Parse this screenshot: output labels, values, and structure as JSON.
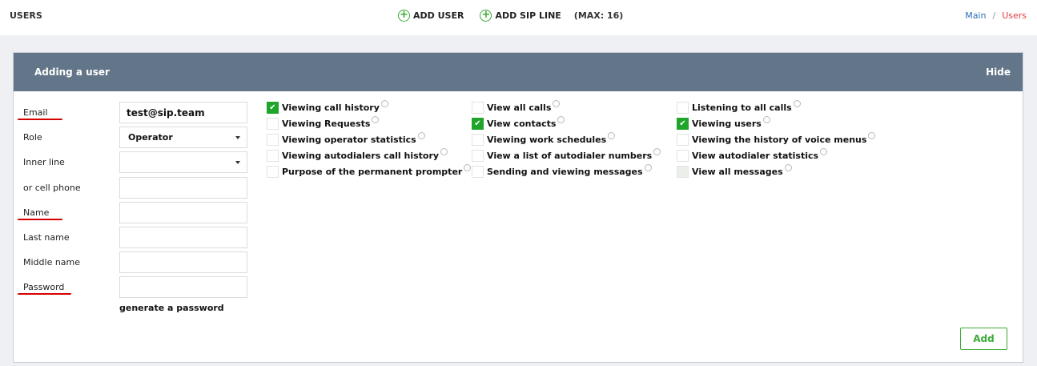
{
  "header": {
    "title": "USERS",
    "add_user": "ADD USER",
    "add_sip_line": "ADD SIP LINE",
    "max": "(MAX: 16)"
  },
  "breadcrumb": {
    "main": "Main",
    "sep": "/",
    "current": "Users"
  },
  "panel": {
    "title": "Adding a user",
    "hide": "Hide"
  },
  "form": {
    "email_label": "Email",
    "email_value": "test@sip.team",
    "role_label": "Role",
    "role_value": "Operator",
    "inner_line_label": "Inner line",
    "inner_line_value": "",
    "cell_label": "or cell phone",
    "cell_value": "",
    "name_label": "Name",
    "name_value": "",
    "last_name_label": "Last name",
    "last_name_value": "",
    "middle_name_label": "Middle name",
    "middle_name_value": "",
    "password_label": "Password",
    "password_value": "",
    "generate": "generate a password"
  },
  "permissions": [
    {
      "label": "Viewing call history",
      "checked": true
    },
    {
      "label": "Viewing Requests",
      "checked": false
    },
    {
      "label": "Viewing operator statistics",
      "checked": false
    },
    {
      "label": "Viewing autodialers call history",
      "checked": false
    },
    {
      "label": "Purpose of the permanent prompter",
      "checked": false
    },
    {
      "label": "View all calls",
      "checked": false
    },
    {
      "label": "View contacts",
      "checked": true
    },
    {
      "label": "Viewing work schedules",
      "checked": false
    },
    {
      "label": "View a list of autodialer numbers",
      "checked": false
    },
    {
      "label": "Sending and viewing messages",
      "checked": false
    },
    {
      "label": "Listening to all calls",
      "checked": false
    },
    {
      "label": "Viewing users",
      "checked": true
    },
    {
      "label": "Viewing the history of voice menus",
      "checked": false
    },
    {
      "label": "View autodialer statistics",
      "checked": false
    },
    {
      "label": "View all messages",
      "checked": false,
      "disabled": true
    }
  ],
  "add_button": "Add",
  "colors": {
    "accent": "#3aaa35",
    "header_bg": "#637588",
    "link": "#2d6db5",
    "active_crumb": "#e04040",
    "required_underline": "#d60000"
  }
}
